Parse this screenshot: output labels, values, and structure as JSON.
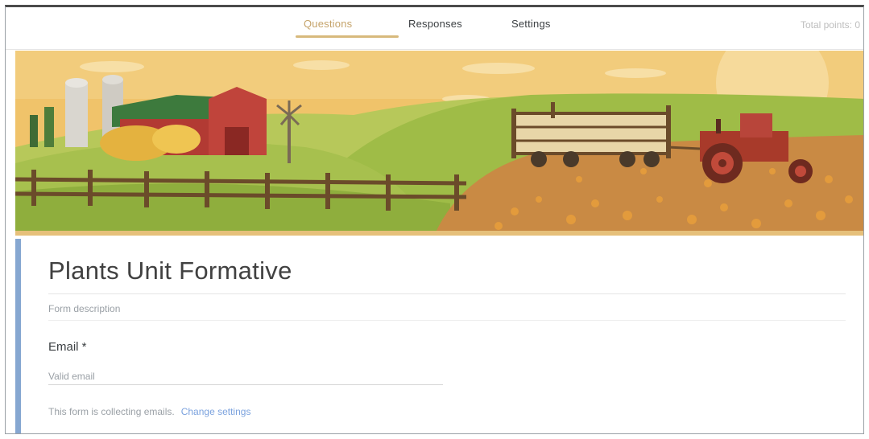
{
  "tabs": {
    "questions": "Questions",
    "responses": "Responses",
    "settings": "Settings"
  },
  "header": {
    "total_points": "Total points: 0"
  },
  "banner": {
    "theme": "farm-harvest-illustration",
    "colors": {
      "sky": "#f0c36a",
      "sky_light": "#f7dba2",
      "hill": "#9fbc47",
      "hill_dark": "#7e9a36",
      "barn": "#b23a33",
      "fence": "#6b4b2a",
      "pumpkin_field": "#c98a44",
      "tractor": "#a83a2a",
      "silo": "#d9d6cf",
      "roof_green": "#3d7a3d",
      "bottom_stripe": "#d9b15c"
    }
  },
  "form": {
    "title": "Plants Unit Formative",
    "description_placeholder": "Form description",
    "accent_color": "#86a7d1",
    "email": {
      "label": "Email *",
      "placeholder": "Valid email"
    },
    "collect_note": "This form is collecting emails.",
    "change_settings_link": "Change settings"
  }
}
